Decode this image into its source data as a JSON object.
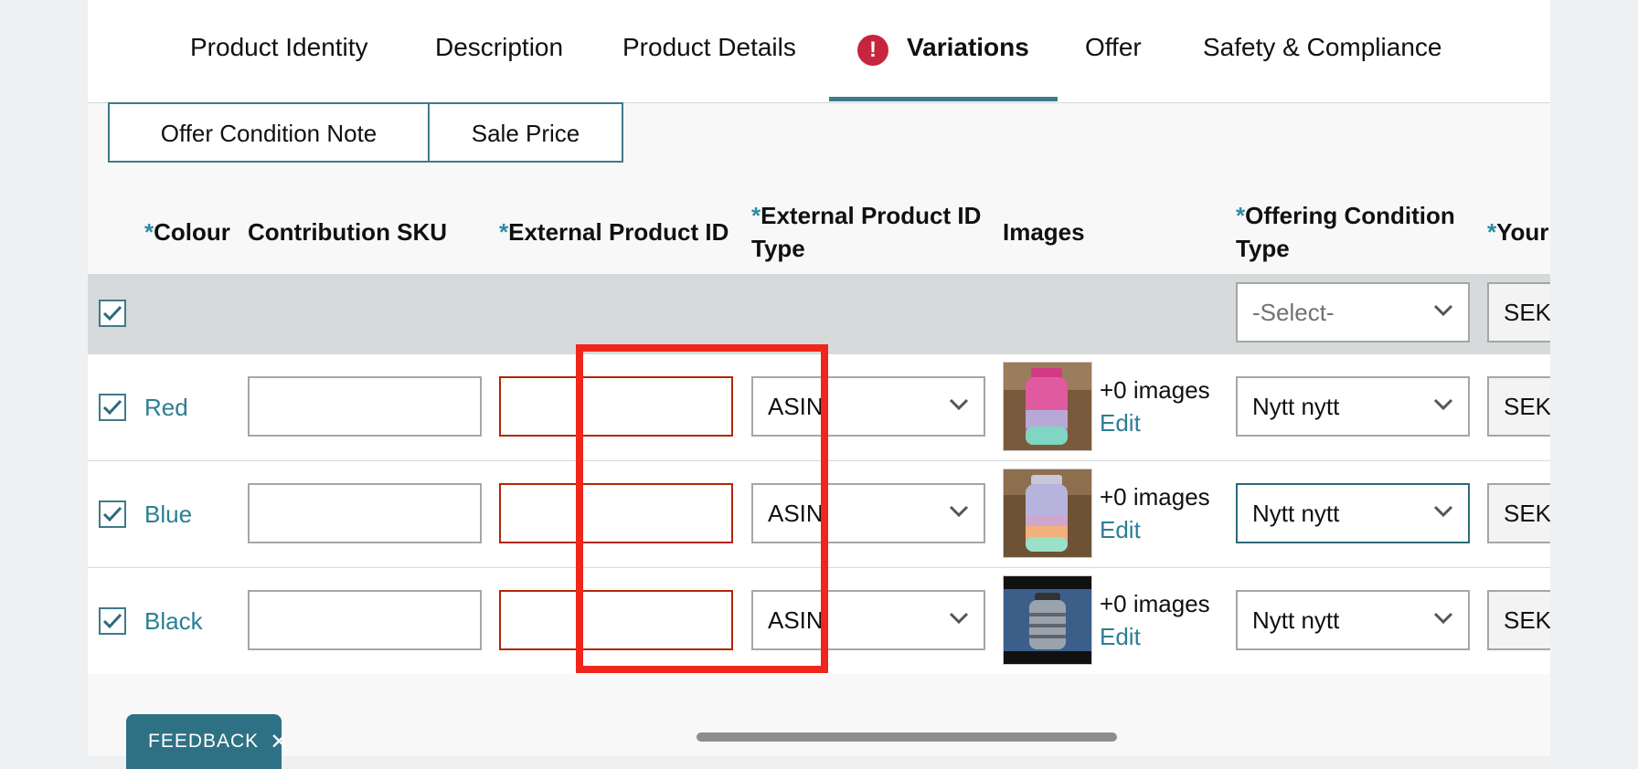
{
  "tabs": [
    {
      "label": "Product Identity",
      "active": false,
      "alert": false
    },
    {
      "label": "Description",
      "active": false,
      "alert": false
    },
    {
      "label": "Product Details",
      "active": false,
      "alert": false
    },
    {
      "label": "Variations",
      "active": true,
      "alert": true
    },
    {
      "label": "Offer",
      "active": false,
      "alert": false
    },
    {
      "label": "Safety & Compliance",
      "active": false,
      "alert": false
    }
  ],
  "alert_icon": {
    "name": "exclamation-alert-icon",
    "glyph": "!"
  },
  "subtabs": [
    {
      "label": "Offer Condition Note"
    },
    {
      "label": "Sale Price"
    }
  ],
  "columns": [
    {
      "required": true,
      "line1": "Colour",
      "line2": ""
    },
    {
      "required": false,
      "line1": "Contribution SKU",
      "line2": ""
    },
    {
      "required": true,
      "line1": "External Product ID",
      "line2": ""
    },
    {
      "required": true,
      "line1": "External Product ID",
      "line2": "Type"
    },
    {
      "required": false,
      "line1": "Images",
      "line2": ""
    },
    {
      "required": true,
      "line1": "Offering Condition",
      "line2": "Type"
    },
    {
      "required": true,
      "line1": "Your",
      "line2": ""
    }
  ],
  "required_marker": "*",
  "bulk_row": {
    "checked": true,
    "condition_placeholder": "-Select-",
    "currency": "SEK"
  },
  "rows": [
    {
      "checked": true,
      "colour": "Red",
      "contribution_sku": "",
      "external_id": "",
      "id_type": "ASIN",
      "images_count": "+0 images",
      "edit": "Edit",
      "condition": "Nytt nytt",
      "currency": "SEK"
    },
    {
      "checked": true,
      "colour": "Blue",
      "contribution_sku": "",
      "external_id": "",
      "id_type": "ASIN",
      "images_count": "+0 images",
      "edit": "Edit",
      "condition": "Nytt nytt",
      "currency": "SEK"
    },
    {
      "checked": true,
      "colour": "Black",
      "contribution_sku": "",
      "external_id": "",
      "id_type": "ASIN",
      "images_count": "+0 images",
      "edit": "Edit",
      "condition": "Nytt nytt",
      "currency": "SEK"
    }
  ],
  "feedback": {
    "label": "FEEDBACK",
    "close": "✕"
  },
  "colors": {
    "accent": "#3f7a8a",
    "link": "#2b7e95",
    "error": "#b12704",
    "highlight": "#f0261b",
    "alert": "#c7253e"
  }
}
